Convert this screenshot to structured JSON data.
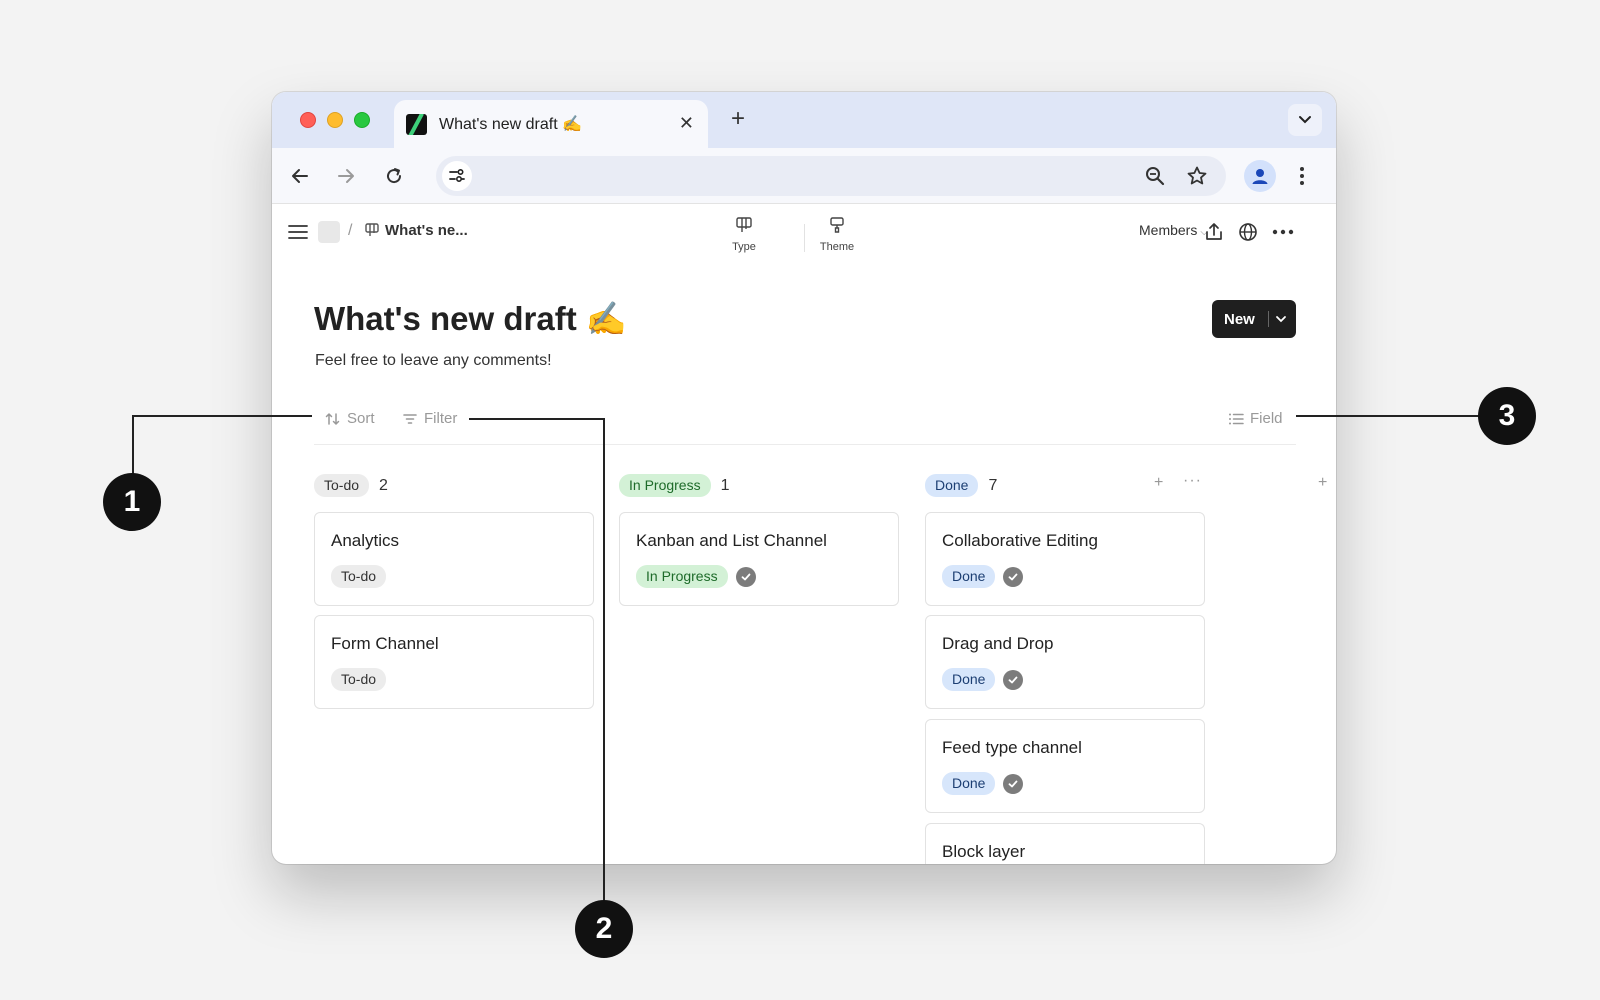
{
  "browser": {
    "tab_title": "What's new draft ✍️",
    "close_glyph": "✕",
    "new_tab_glyph": "+"
  },
  "app": {
    "breadcrumb": {
      "separator": "/",
      "page_title": "What's ne..."
    },
    "view_buttons": {
      "type_label": "Type",
      "theme_label": "Theme"
    },
    "members_label": "Members"
  },
  "page": {
    "title": "What's new draft ✍️",
    "description": "Feel free to leave any comments!",
    "new_button_label": "New"
  },
  "controls": {
    "sort_label": "Sort",
    "filter_label": "Filter",
    "field_label": "Field"
  },
  "board": {
    "columns": [
      {
        "status": "To-do",
        "count": "2",
        "cards": [
          {
            "title": "Analytics",
            "tag": "To-do"
          },
          {
            "title": "Form Channel",
            "tag": "To-do"
          }
        ]
      },
      {
        "status": "In Progress",
        "count": "1",
        "cards": [
          {
            "title": "Kanban and List Channel",
            "tag": "In Progress"
          }
        ]
      },
      {
        "status": "Done",
        "count": "7",
        "cards": [
          {
            "title": "Collaborative Editing",
            "tag": "Done"
          },
          {
            "title": "Drag and Drop",
            "tag": "Done"
          },
          {
            "title": "Feed type channel",
            "tag": "Done"
          },
          {
            "title": "Block layer",
            "tag": ""
          }
        ]
      }
    ],
    "add_glyph": "+",
    "more_glyph": "···"
  },
  "callouts": [
    "1",
    "2",
    "3"
  ],
  "colors": {
    "todo_pill": "#ececec",
    "in_progress_pill": "#d3f1d6",
    "done_pill": "#d7e6fb",
    "new_button": "#1f1f1f",
    "tab_strip": "#dfe6f7"
  },
  "icons": [
    "back-arrow-icon",
    "forward-arrow-icon",
    "reload-icon",
    "site-info-icon",
    "zoom-icon",
    "star-icon",
    "profile-icon",
    "kebab-icon",
    "hamburger-icon",
    "share-icon",
    "globe-icon",
    "sort-icon",
    "filter-icon",
    "list-icon",
    "check-icon"
  ]
}
